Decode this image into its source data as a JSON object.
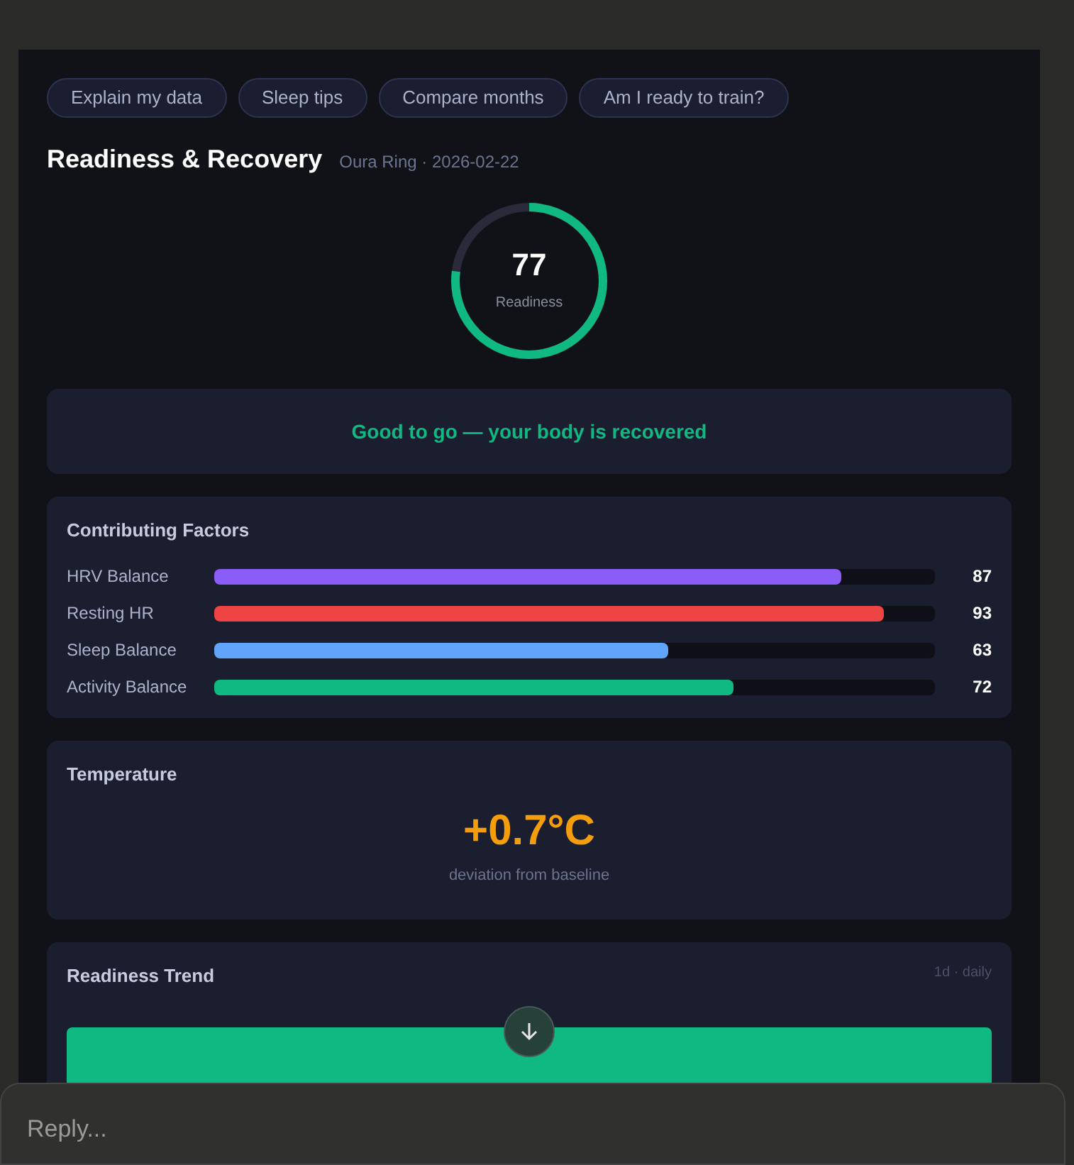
{
  "suggestions": [
    "Explain my data",
    "Sleep tips",
    "Compare months",
    "Am I ready to train?"
  ],
  "header": {
    "title": "Readiness & Recovery",
    "subtitle": "Oura Ring · 2026-02-22"
  },
  "score": {
    "value": "77",
    "label": "Readiness",
    "level": 0.77
  },
  "status": "Good to go — your body is recovered",
  "factors": {
    "title": "Contributing Factors",
    "items": [
      {
        "name": "HRV Balance",
        "value": "87",
        "level": 0.87,
        "color": "#8b5cf6"
      },
      {
        "name": "Resting HR",
        "value": "93",
        "level": 0.93,
        "color": "#ef4444"
      },
      {
        "name": "Sleep Balance",
        "value": "63",
        "level": 0.63,
        "color": "#60a5fa"
      },
      {
        "name": "Activity Balance",
        "value": "72",
        "level": 0.72,
        "color": "#10b981"
      }
    ]
  },
  "temperature": {
    "title": "Temperature",
    "value": "+0.7°C",
    "caption": "deviation from baseline"
  },
  "trend": {
    "title": "Readiness Trend",
    "range": "1d · daily"
  },
  "reply": {
    "placeholder": "Reply..."
  }
}
